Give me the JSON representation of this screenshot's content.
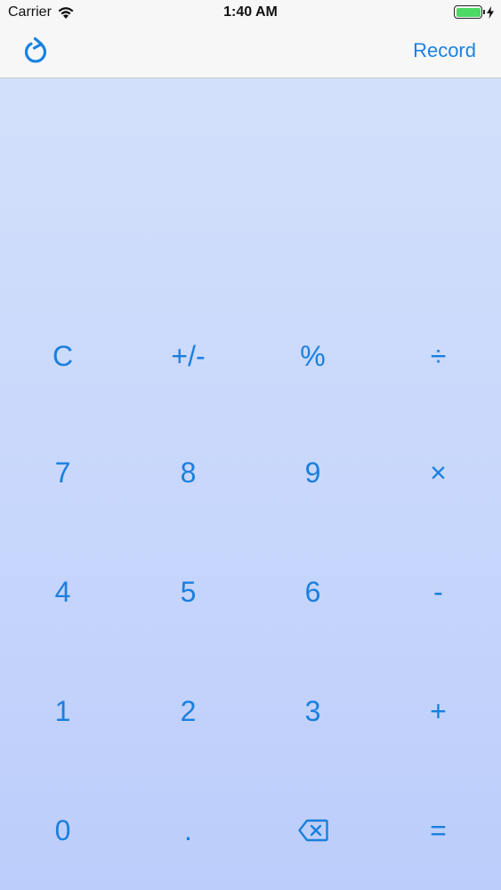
{
  "status_bar": {
    "carrier": "Carrier",
    "time": "1:40 AM",
    "battery_color": "#4cd964"
  },
  "nav": {
    "refresh_icon": "refresh-icon",
    "record_label": "Record"
  },
  "display": {
    "value": ""
  },
  "accent_color": "#1a82e2",
  "keys": {
    "row1": [
      "C",
      "+/-",
      "%",
      "÷"
    ],
    "row2": [
      "7",
      "8",
      "9",
      "×"
    ],
    "row3": [
      "4",
      "5",
      "6",
      "-"
    ],
    "row4": [
      "1",
      "2",
      "3",
      "+"
    ],
    "row5": [
      "0",
      ".",
      "backspace-icon",
      "="
    ]
  }
}
